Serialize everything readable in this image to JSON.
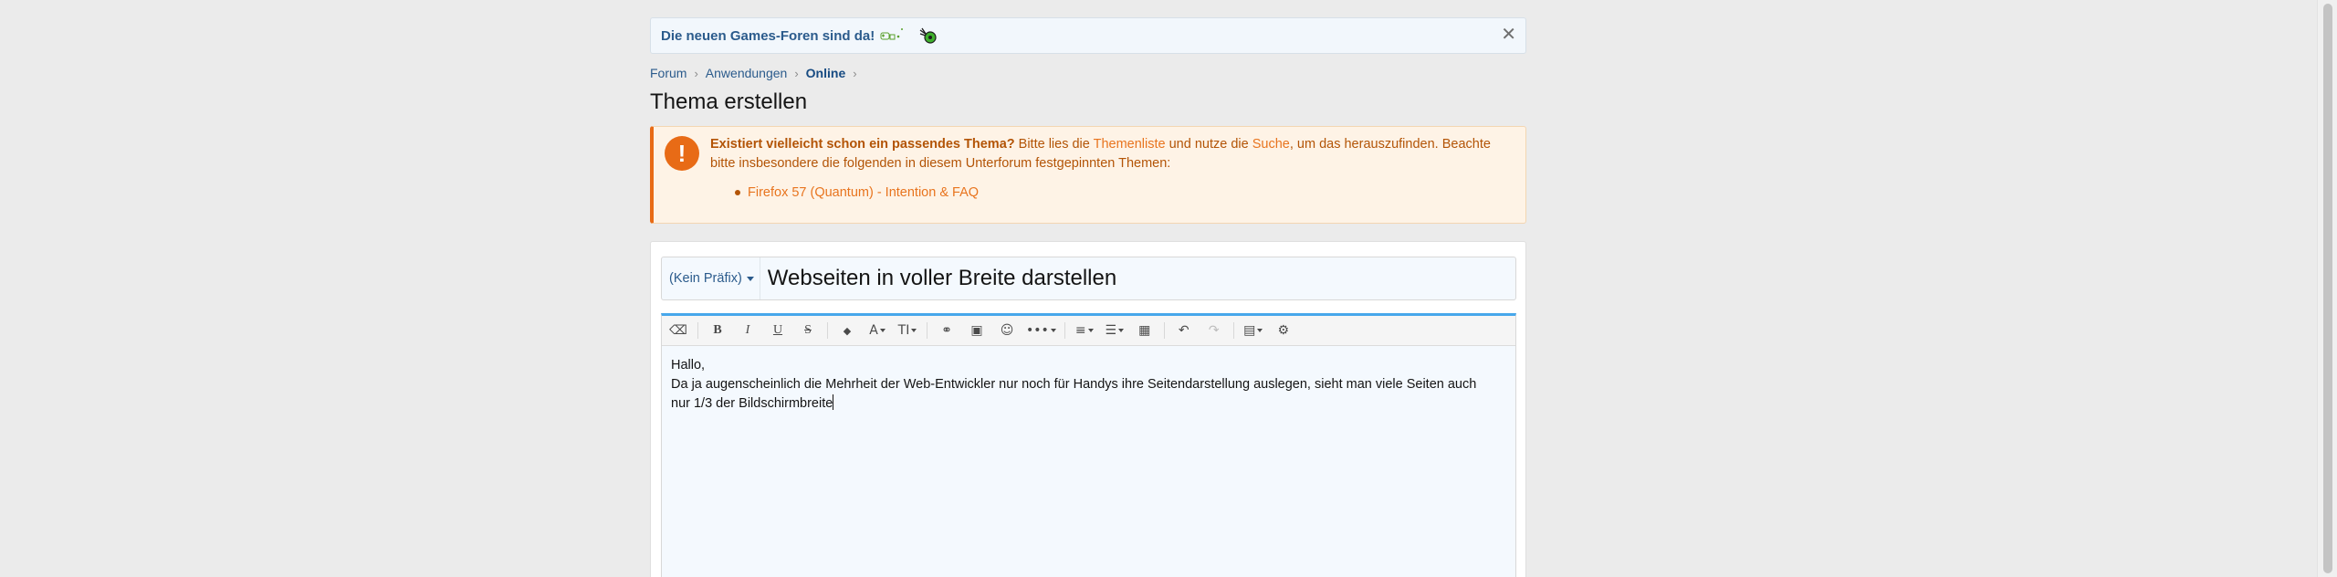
{
  "notice": {
    "text": "Die neuen Games-Foren sind da!",
    "icons": [
      "game-controller-icon",
      "mouse-icon"
    ],
    "close_label": "✕"
  },
  "breadcrumb": {
    "items": [
      "Forum",
      "Anwendungen",
      "Online"
    ],
    "separator": "›"
  },
  "page_title": "Thema erstellen",
  "warning": {
    "icon_label": "!",
    "strong": "Existiert vielleicht schon ein passendes Thema?",
    "text_1": " Bitte lies die ",
    "link_1": "Themenliste",
    "text_2": " und nutze die ",
    "link_2": "Suche",
    "text_3": ", um das herauszufinden. Beachte bitte insbesondere die folgenden in diesem Unterforum festgepinnten Themen:",
    "pinned": [
      "Firefox 57 (Quantum) - Intention & FAQ"
    ],
    "color": "#e86b16"
  },
  "form": {
    "prefix_label": "(Kein Präfix)",
    "title_value": "Webseiten in voller Breite darstellen",
    "editor_lines": [
      "Hallo,",
      "Da ja augenscheinlich die Mehrheit der Web-Entwickler nur noch für Handys ihre Seitendarstellung auslegen, sieht man viele Seiten auch",
      "nur 1/3 der Bildschirmbreite"
    ],
    "accent": "#47a7eb"
  },
  "toolbar": {
    "eraser": "⌫",
    "bold": "B",
    "italic": "I",
    "underline": "U",
    "strike": "S",
    "color": "◆",
    "font_family": "A",
    "font_size": "TI",
    "link": "⚭",
    "image": "▣",
    "smilie": "☺",
    "more": "•••",
    "align": "≡",
    "list": "☰",
    "table": "▦",
    "undo": "↶",
    "redo": "↷",
    "drafts": "▤",
    "settings": "⚙"
  }
}
